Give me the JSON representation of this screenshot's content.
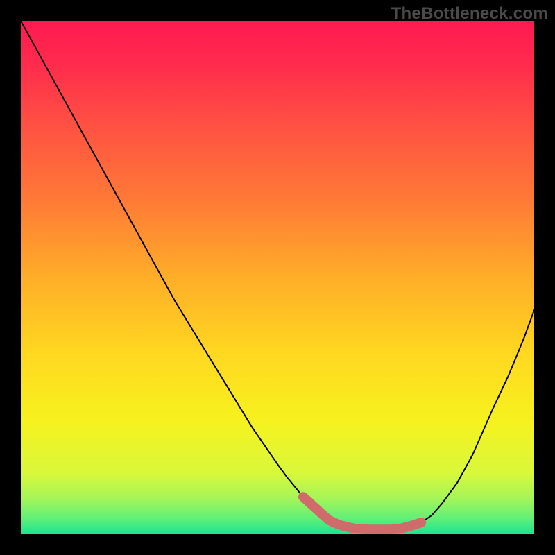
{
  "watermark": "TheBottleneck.com",
  "chart_data": {
    "type": "line",
    "title": "",
    "xlabel": "",
    "ylabel": "",
    "xlim": [
      0,
      100
    ],
    "ylim": [
      0,
      110
    ],
    "x": [
      0,
      5,
      10,
      12,
      15,
      20,
      25,
      30,
      35,
      40,
      45,
      50,
      52,
      55,
      58,
      60,
      62,
      65,
      68,
      70,
      72,
      74,
      76,
      78,
      80,
      82,
      85,
      88,
      90,
      92,
      95,
      98,
      100
    ],
    "y": [
      110,
      100,
      90,
      86,
      80,
      70,
      60,
      50,
      41,
      32,
      23,
      15,
      12,
      8,
      5,
      3,
      2,
      1.2,
      1,
      1,
      1,
      1.2,
      1.8,
      2.5,
      4,
      6.5,
      11,
      17,
      22,
      27,
      34,
      42,
      48
    ],
    "highlight": {
      "comment": "Flat bottom region drawn with a thick muted-red stroke",
      "x": [
        55,
        58,
        60,
        62,
        65,
        68,
        70,
        72,
        74,
        76,
        78
      ],
      "y": [
        8,
        5,
        3,
        2,
        1.2,
        1,
        1,
        1,
        1.2,
        1.8,
        2.5
      ]
    },
    "background_gradient": {
      "stops": [
        {
          "offset": 0.0,
          "color": "#ff1a52"
        },
        {
          "offset": 0.08,
          "color": "#ff2a4d"
        },
        {
          "offset": 0.2,
          "color": "#ff5043"
        },
        {
          "offset": 0.35,
          "color": "#ff7a36"
        },
        {
          "offset": 0.5,
          "color": "#ffae28"
        },
        {
          "offset": 0.65,
          "color": "#ffd820"
        },
        {
          "offset": 0.78,
          "color": "#f6f21e"
        },
        {
          "offset": 0.88,
          "color": "#d9f83a"
        },
        {
          "offset": 0.93,
          "color": "#a6f558"
        },
        {
          "offset": 0.97,
          "color": "#5fef78"
        },
        {
          "offset": 1.0,
          "color": "#18e592"
        }
      ]
    },
    "line_color": "#000000",
    "highlight_color": "#d16a6b"
  }
}
